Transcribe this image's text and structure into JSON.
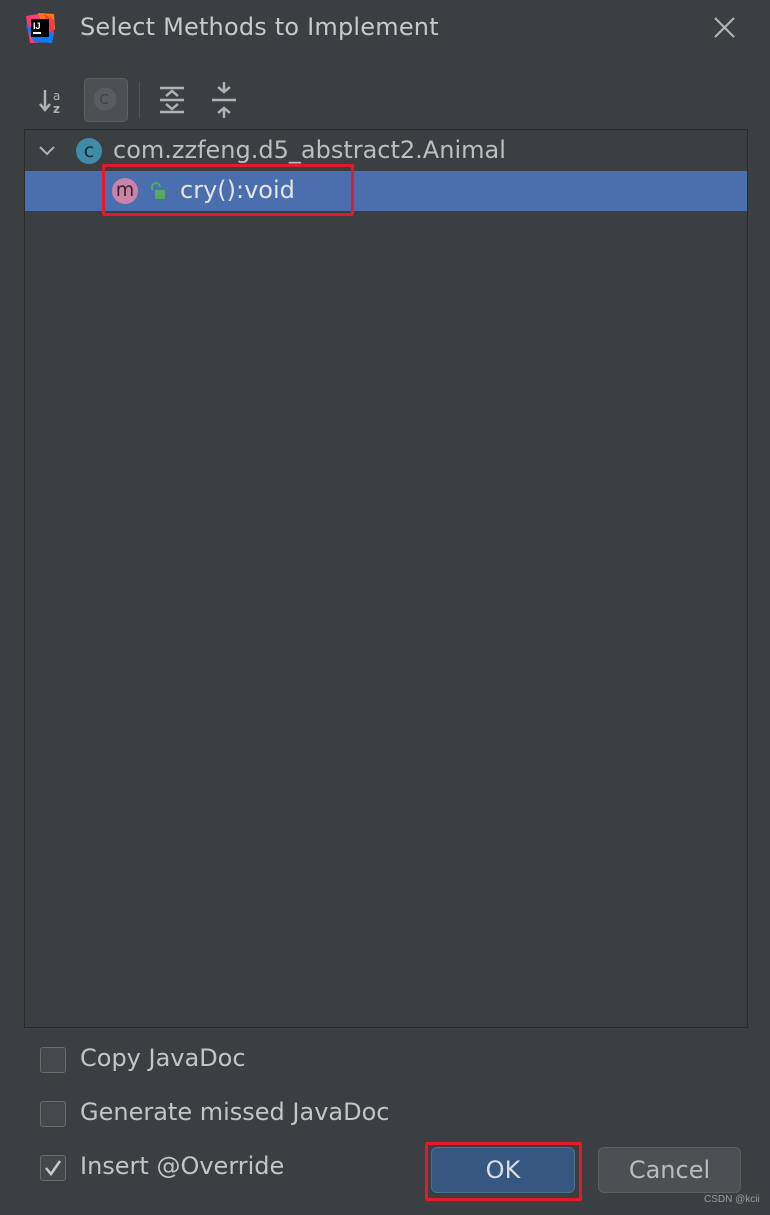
{
  "window": {
    "title": "Select Methods to Implement",
    "app_icon": "intellij-idea-icon",
    "close_icon": "close-icon"
  },
  "toolbar": {
    "buttons": [
      {
        "name": "sort-alphabetically",
        "icon": "sort-alphabetically-icon"
      },
      {
        "name": "show-classes",
        "icon": "class-toggle-icon",
        "pressed": true
      },
      {
        "name": "expand-all",
        "icon": "expand-all-icon"
      },
      {
        "name": "collapse-all",
        "icon": "collapse-all-icon"
      }
    ]
  },
  "tree": {
    "class_node": {
      "badge": "c",
      "label": "com.zzfeng.d5_abstract2.Animal",
      "expanded": true
    },
    "method_node": {
      "badge": "m",
      "label": "cry():void",
      "visibility_icon": "public-lock-icon",
      "selected": true
    }
  },
  "options": {
    "copy_javadoc": {
      "label": "Copy JavaDoc",
      "checked": false
    },
    "generate_missed_javadoc": {
      "label": "Generate missed JavaDoc",
      "checked": false
    },
    "insert_override": {
      "label": "Insert @Override",
      "checked": true
    }
  },
  "buttons": {
    "ok": "OK",
    "cancel": "Cancel"
  },
  "watermark": "CSDN @kcii",
  "colors": {
    "background": "#3c3f41",
    "selection": "#4b6eaf",
    "ok_button": "#365880",
    "class_badge": "#3f8ba8",
    "method_badge": "#c983a8",
    "annotation_box": "#e5192b",
    "public_lock": "#59a869"
  }
}
